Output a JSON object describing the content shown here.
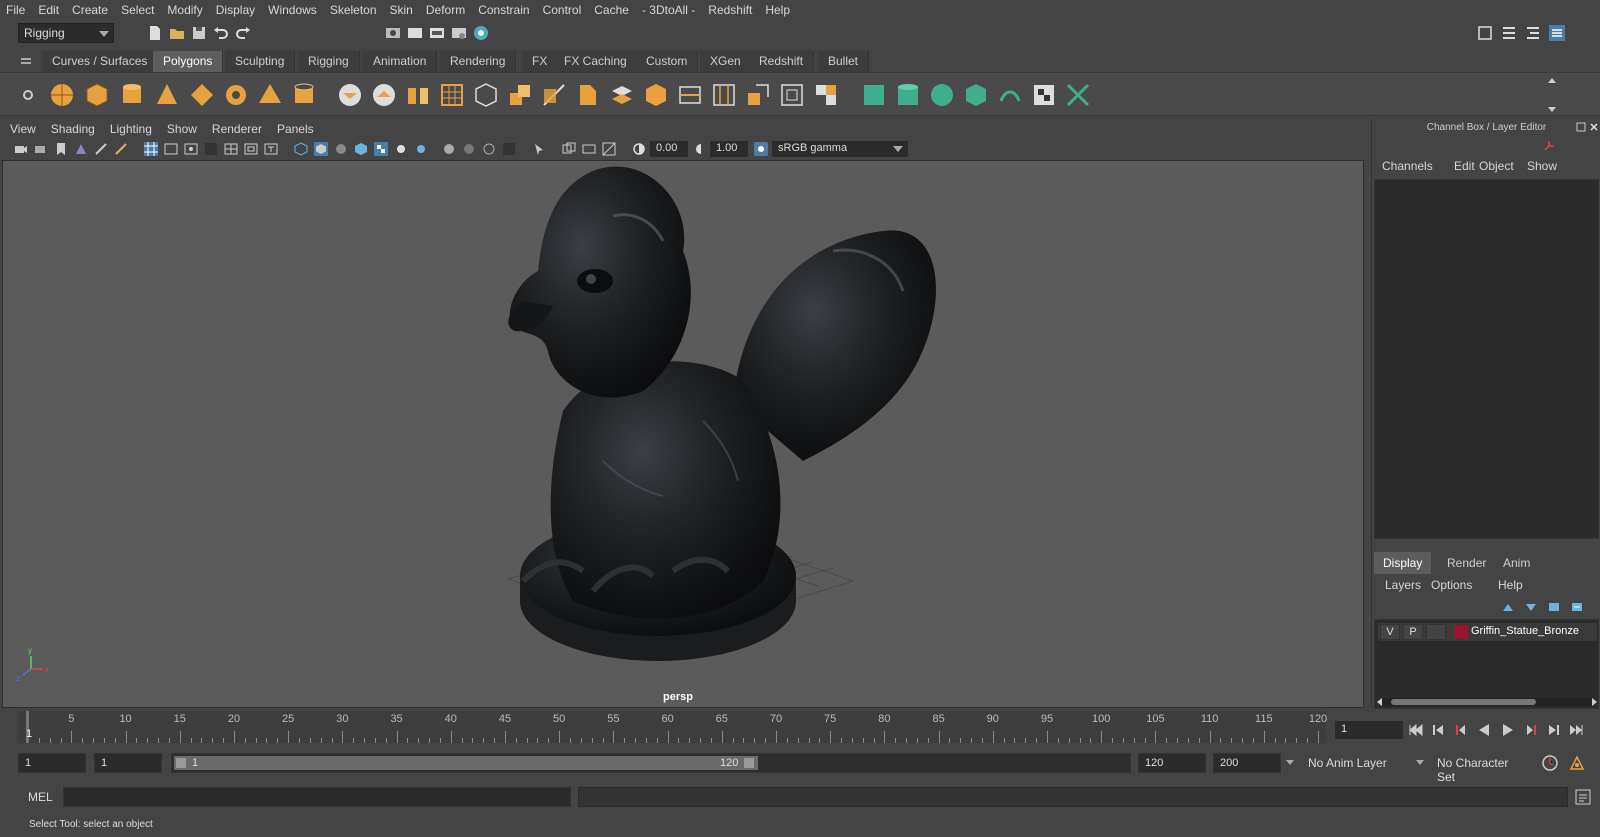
{
  "menubar": {
    "items": [
      "File",
      "Edit",
      "Create",
      "Select",
      "Modify",
      "Display",
      "Windows",
      "Skeleton",
      "Skin",
      "Deform",
      "Constrain",
      "Control",
      "Cache",
      "- 3DtoAll -",
      "Redshift",
      "Help"
    ]
  },
  "statusline": {
    "mode": "Rigging"
  },
  "shelf": {
    "tabs": [
      "Curves / Surfaces",
      "Polygons",
      "Sculpting",
      "Rigging",
      "Animation",
      "Rendering",
      "FX",
      "FX Caching",
      "Custom",
      "XGen",
      "Redshift",
      "Bullet"
    ],
    "active_tab": "Polygons"
  },
  "viewport": {
    "menu": [
      "View",
      "Shading",
      "Lighting",
      "Show",
      "Renderer",
      "Panels"
    ],
    "exposure": "0.00",
    "gamma": "1.00",
    "color_space": "sRGB gamma",
    "camera_label": "persp",
    "axis_labels": {
      "x": "x",
      "y": "y",
      "z": "z"
    }
  },
  "channel_box": {
    "title": "Channel Box / Layer Editor",
    "menu": [
      "Channels",
      "Edit",
      "Object",
      "Show"
    ]
  },
  "layer_editor": {
    "tabs": [
      "Display",
      "Render",
      "Anim"
    ],
    "active_tab": "Display",
    "menu": [
      "Layers",
      "Options",
      "Help"
    ],
    "layers": [
      {
        "visible": "V",
        "playback": "P",
        "name": "Griffin_Statue_Bronze",
        "color": "#9a1530"
      }
    ]
  },
  "timeline": {
    "ticks": [
      "5",
      "10",
      "15",
      "20",
      "25",
      "30",
      "35",
      "40",
      "45",
      "50",
      "55",
      "60",
      "65",
      "70",
      "75",
      "80",
      "85",
      "90",
      "95",
      "100",
      "105",
      "110",
      "115",
      "120"
    ],
    "current_frame_marker": "1",
    "current_frame": "1"
  },
  "range": {
    "start": "1",
    "playback_start": "1",
    "slider_start": "1",
    "slider_end": "120",
    "playback_end": "120",
    "end": "200",
    "anim_layer": "No Anim Layer",
    "character_set": "No Character Set"
  },
  "commandline": {
    "label": "MEL"
  },
  "helpline": {
    "text": "Select Tool: select an object"
  },
  "colors": {
    "accent_orange": "#e8a13f",
    "accent_green": "#3fae8e",
    "active_tab": "#5d5d5d",
    "viewport_bg": "#5b5b5b"
  }
}
